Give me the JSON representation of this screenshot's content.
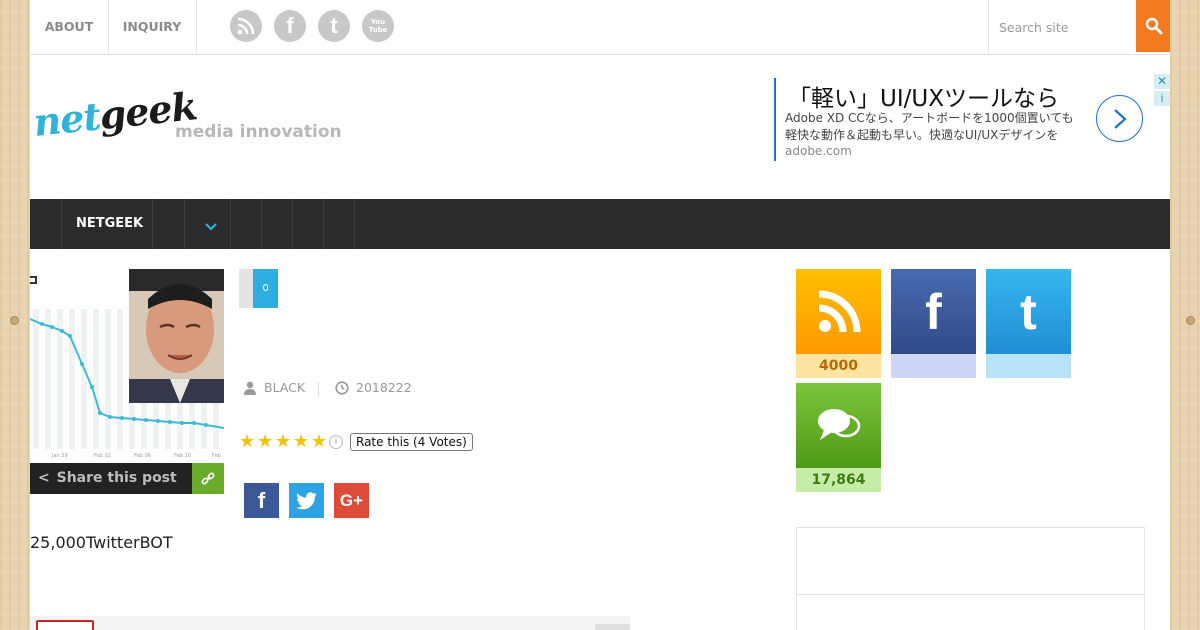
{
  "topbar": {
    "links": [
      "ABOUT",
      "INQUIRY"
    ],
    "social_icons": [
      "rss-icon",
      "facebook-icon",
      "twitter-icon",
      "youtube-icon"
    ],
    "youtube_text": "You Tube",
    "search_placeholder": "Search site"
  },
  "header": {
    "logo_part1": "net",
    "logo_part2": "geek",
    "tagline": "media innovation"
  },
  "ad": {
    "title": "「軽い」UI/UXツールなら",
    "body": "Adobe XD CCなら、アートボードを1000個置いても軽快な動作＆起動も早い。快適なUI/UXデザインを",
    "domain": "adobe.com",
    "close": "✕",
    "info": "i"
  },
  "nav": {
    "items": [
      "NETGEEK"
    ]
  },
  "article": {
    "comment_count": "0",
    "author": "BLACK",
    "date": "2018222",
    "rating_label": "Rate this (4 Votes)",
    "rating_stars": 5,
    "share_label": "Share this post",
    "share_buttons": [
      "facebook-icon",
      "twitter-icon",
      "google-plus-icon"
    ],
    "lead_text": "25,000TwitterBOT",
    "chart_ticks": [
      "Jan 29",
      "Feb 02",
      "Feb 06",
      "Feb 10",
      "Feb"
    ]
  },
  "sidebar": {
    "counters": [
      {
        "name": "rss",
        "count": "4000",
        "color": "#ffa300"
      },
      {
        "name": "facebook",
        "count": "",
        "color": "#3b5998"
      },
      {
        "name": "twitter",
        "count": "",
        "color": "#2ea3e3"
      },
      {
        "name": "comments",
        "count": "17,864",
        "color": "#5fae1e"
      }
    ]
  },
  "colors": {
    "accent_orange": "#f47a20",
    "nav_bg": "#2b2b2b",
    "link_blue": "#2eaee0"
  }
}
